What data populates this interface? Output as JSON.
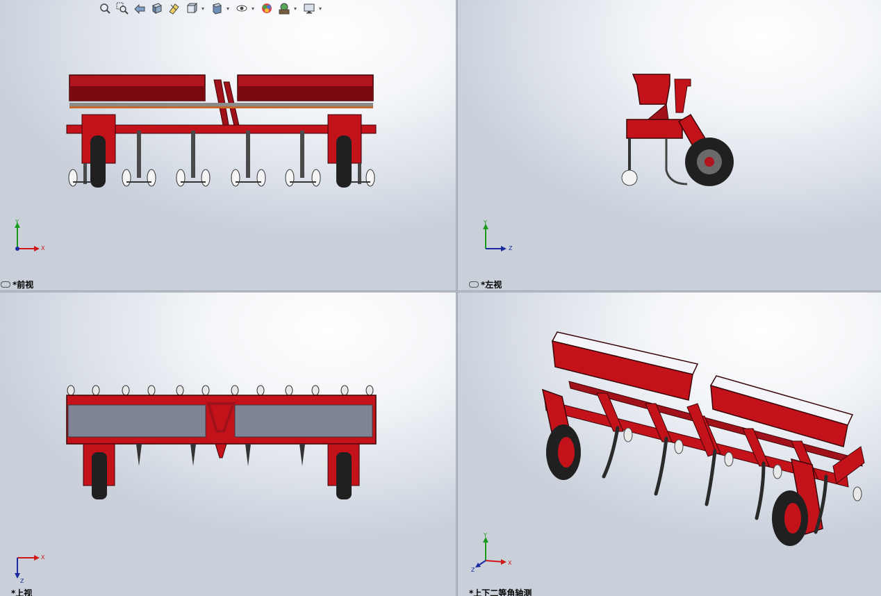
{
  "toolbar": {
    "items": [
      {
        "icon": "zoom-to-fit-icon"
      },
      {
        "icon": "zoom-to-area-icon"
      },
      {
        "icon": "previous-view-icon"
      },
      {
        "icon": "section-view-icon"
      },
      {
        "icon": "dynamic-annotation-icon"
      },
      {
        "icon": "view-orientation-icon"
      },
      {
        "icon": "display-style-icon"
      },
      {
        "icon": "hide-show-items-icon"
      },
      {
        "icon": "edit-appearance-icon"
      },
      {
        "icon": "apply-scene-icon"
      },
      {
        "icon": "view-settings-icon"
      }
    ]
  },
  "viewports": {
    "front": {
      "label": "*前视",
      "triad": {
        "up": "Y",
        "right": "X"
      }
    },
    "left": {
      "label": "*左视",
      "triad": {
        "up": "Y",
        "right": "Z"
      }
    },
    "top": {
      "label": "*上视",
      "triad": {
        "down": "Z",
        "right": "X"
      }
    },
    "iso": {
      "label": "*上下二等角轴测",
      "triad": {
        "up": "Y",
        "right": "X",
        "diag": "Z"
      }
    }
  },
  "colors": {
    "frame_red": "#c4121b",
    "frame_dark_red": "#7a0a10",
    "tire_black": "#202020",
    "hopper_lid_gray": "#7f8597",
    "hopper_top_white": "#f2f4fa",
    "metal_gray": "#5a5a5a"
  }
}
